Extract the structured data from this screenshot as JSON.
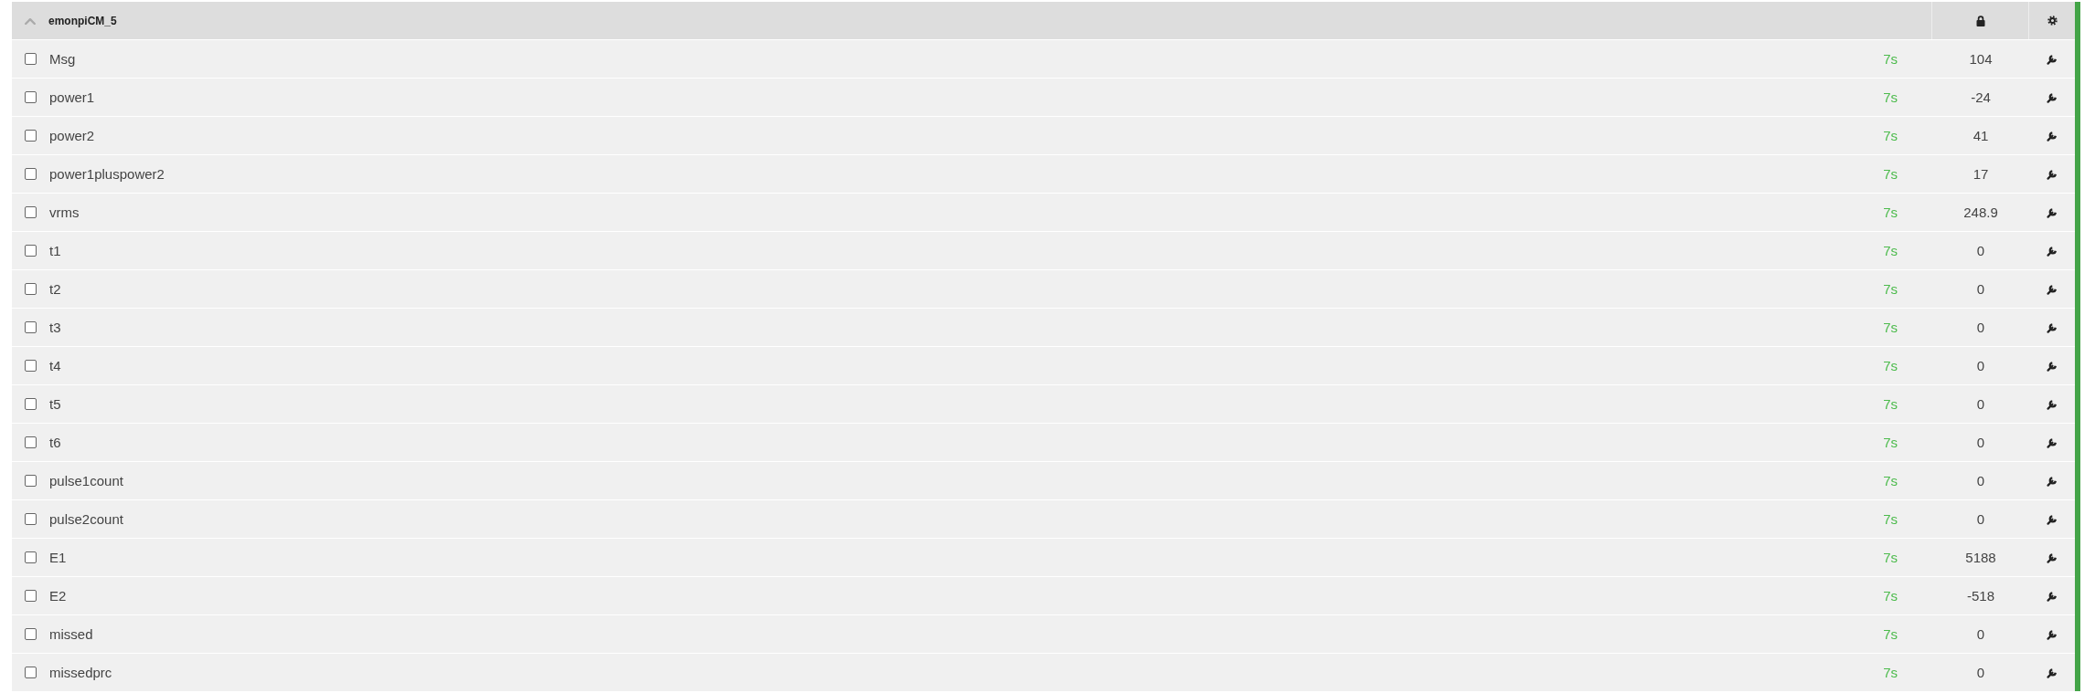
{
  "node": {
    "name": "emonpiCM_5",
    "expanded": true,
    "inputs": [
      {
        "name": "Msg",
        "checked": false,
        "time": "7s",
        "value": "104"
      },
      {
        "name": "power1",
        "checked": false,
        "time": "7s",
        "value": "-24"
      },
      {
        "name": "power2",
        "checked": false,
        "time": "7s",
        "value": "41"
      },
      {
        "name": "power1pluspower2",
        "checked": false,
        "time": "7s",
        "value": "17"
      },
      {
        "name": "vrms",
        "checked": false,
        "time": "7s",
        "value": "248.9"
      },
      {
        "name": "t1",
        "checked": false,
        "time": "7s",
        "value": "0"
      },
      {
        "name": "t2",
        "checked": false,
        "time": "7s",
        "value": "0"
      },
      {
        "name": "t3",
        "checked": false,
        "time": "7s",
        "value": "0"
      },
      {
        "name": "t4",
        "checked": false,
        "time": "7s",
        "value": "0"
      },
      {
        "name": "t5",
        "checked": false,
        "time": "7s",
        "value": "0"
      },
      {
        "name": "t6",
        "checked": false,
        "time": "7s",
        "value": "0"
      },
      {
        "name": "pulse1count",
        "checked": false,
        "time": "7s",
        "value": "0"
      },
      {
        "name": "pulse2count",
        "checked": false,
        "time": "7s",
        "value": "0"
      },
      {
        "name": "E1",
        "checked": false,
        "time": "7s",
        "value": "5188"
      },
      {
        "name": "E2",
        "checked": false,
        "time": "7s",
        "value": "-518"
      },
      {
        "name": "missed",
        "checked": false,
        "time": "7s",
        "value": "0"
      },
      {
        "name": "missedprc",
        "checked": false,
        "time": "7s",
        "value": "0"
      }
    ]
  }
}
